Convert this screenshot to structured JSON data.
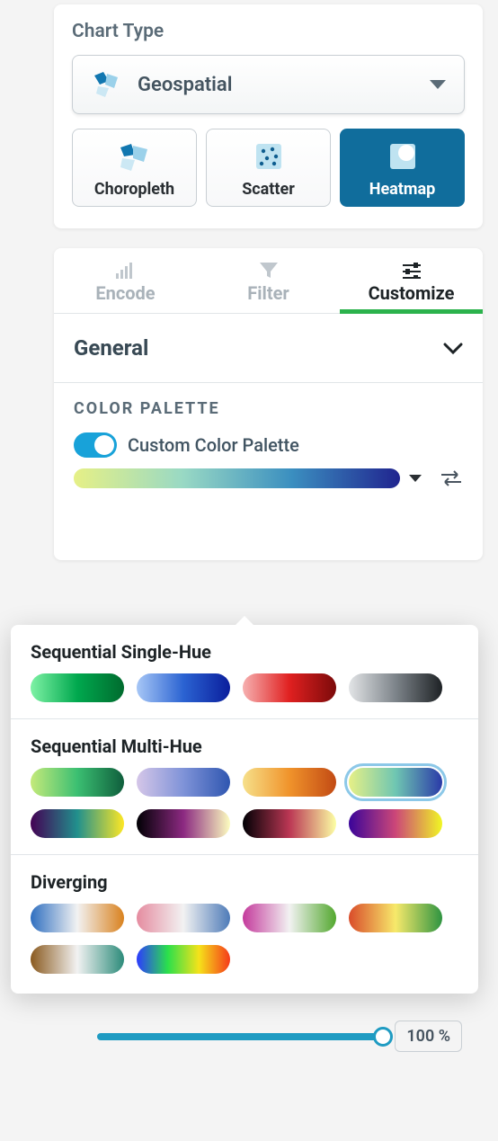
{
  "chartType": {
    "title": "Chart Type",
    "selected": "Geospatial",
    "options": [
      {
        "label": "Choropleth",
        "active": false
      },
      {
        "label": "Scatter",
        "active": false
      },
      {
        "label": "Heatmap",
        "active": true
      }
    ]
  },
  "tabs": [
    {
      "label": "Encode",
      "active": false
    },
    {
      "label": "Filter",
      "active": false
    },
    {
      "label": "Customize",
      "active": true
    }
  ],
  "accordion": {
    "general": "General"
  },
  "palette": {
    "section_label": "COLOR PALETTE",
    "toggle_label": "Custom Color Palette",
    "toggle_on": true,
    "selected_gradient": "viridis-like",
    "popover": {
      "groups": [
        {
          "title": "Sequential Single-Hue",
          "swatches": [
            {
              "name": "greens",
              "css": "linear-gradient(90deg,#7ef2a5,#00a84e,#006b2e)"
            },
            {
              "name": "blues",
              "css": "linear-gradient(90deg,#a7c7f6,#2b63d2,#0a1e9c)"
            },
            {
              "name": "reds",
              "css": "linear-gradient(90deg,#f6b0b0,#e02020,#7b0a0a)"
            },
            {
              "name": "greys",
              "css": "linear-gradient(90deg,#e2e4e6,#7d848a,#1e2225)"
            }
          ]
        },
        {
          "title": "Sequential Multi-Hue",
          "swatches": [
            {
              "name": "green-emerald",
              "css": "linear-gradient(90deg,#c5ea7a,#3bbf72,#0f5e3c)"
            },
            {
              "name": "lilac-blue",
              "css": "linear-gradient(90deg,#d5c6e8,#7f93d8,#2f56b0)"
            },
            {
              "name": "orange-amber",
              "css": "linear-gradient(90deg,#f6e08a,#f0932b,#c24a14)"
            },
            {
              "name": "yellow-green-blue",
              "css": "linear-gradient(90deg,#e6f086,#6fc6b2,#2a3aa8)",
              "selected": true
            },
            {
              "name": "viridis",
              "css": "linear-gradient(90deg,#440154,#21908d,#fde725)"
            },
            {
              "name": "magma",
              "css": "linear-gradient(90deg,#000004,#8c2981,#fcfdbf)"
            },
            {
              "name": "inferno",
              "css": "linear-gradient(90deg,#000004,#bb3754,#fcffa4)"
            },
            {
              "name": "plasma",
              "css": "linear-gradient(90deg,#3a049a,#cc4778,#f0f724)"
            }
          ]
        },
        {
          "title": "Diverging",
          "swatches": [
            {
              "name": "blue-orange",
              "css": "linear-gradient(90deg,#2f6fc0,#f2f2f2,#d9821f)"
            },
            {
              "name": "pink-blue",
              "css": "linear-gradient(90deg,#e58ca0,#f2f2f2,#4e7bb8)"
            },
            {
              "name": "magenta-green",
              "css": "linear-gradient(90deg,#c43a9c,#f2f2f2,#53a82f)"
            },
            {
              "name": "red-green",
              "css": "linear-gradient(90deg,#d94c2a,#f7e96b,#2e9441)"
            },
            {
              "name": "brown-teal",
              "css": "linear-gradient(90deg,#8a5a1f,#f2f2f2,#2c8b7a)"
            },
            {
              "name": "rainbow",
              "css": "linear-gradient(90deg,#2d3bff,#2be04b,#f5e21a,#f53a1a)"
            }
          ]
        }
      ]
    }
  },
  "slider": {
    "value": "100 %"
  }
}
